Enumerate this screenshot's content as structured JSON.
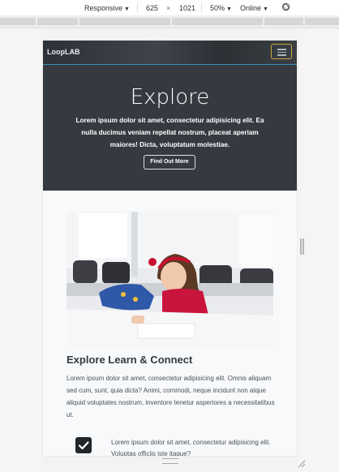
{
  "devtools": {
    "device_mode": "Responsive",
    "width": "625",
    "separator": "×",
    "height": "1021",
    "zoom": "50%",
    "network": "Online",
    "rotate_icon": "rotate-icon",
    "caret_icon": "▼"
  },
  "page": {
    "brand": "LoopLAB",
    "menu_icon": "hamburger-icon",
    "hero": {
      "title": "Explore",
      "text": "Lorem ipsum dolor sit amet, consectetur adipisicing elit. Ea nulla ducimus veniam repellat nostrum, placeat aperiam maiores! Dicta, voluptatum molestiae.",
      "button": "Find Out More"
    },
    "section": {
      "title": "Explore Learn & Connect",
      "text": "Lorem ipsum dolor sit amet, consectetur adipisicing elit. Omnis aliquam sed cum, sunt, quia dicta? Animi, commodi, neque incidunt non atque aliquid voluptates nostrum, inventore tenetur asperiores a necessitatibus ut.",
      "check_icon": "check-icon",
      "feature_text": "Lorem ipsum dolor sit amet, consectetur adipisicing elit. Voluptas officiis iste itaque?"
    },
    "colors": {
      "navbar": "#343a40",
      "hero_bg": "#343a40",
      "toggler_border": "#c9a53a",
      "accent_line": "#3a8fb0"
    }
  }
}
